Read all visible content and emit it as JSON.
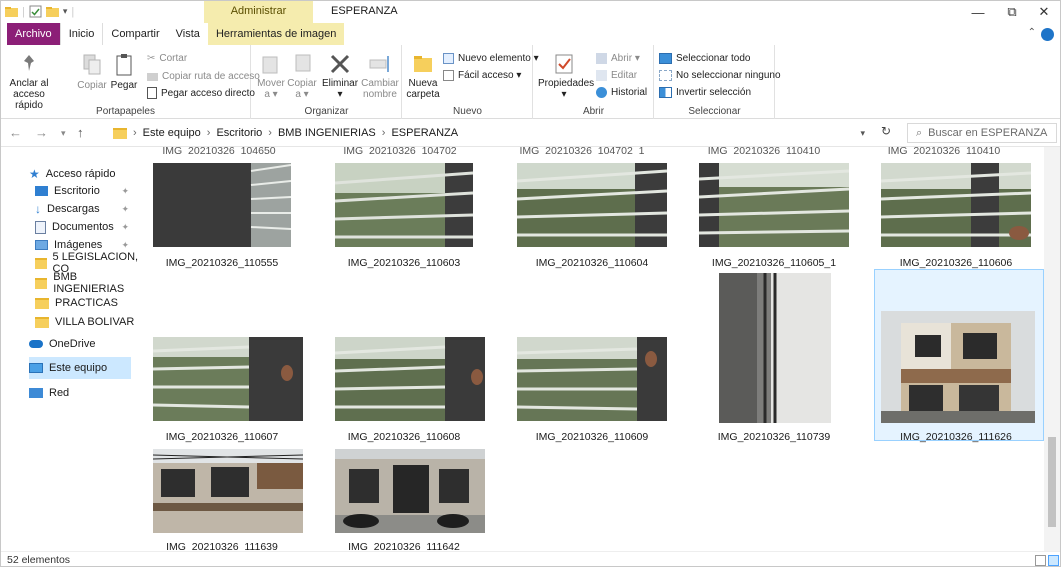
{
  "titlebar": {
    "context_tab_header": "Administrar",
    "window_title": "ESPERANZA",
    "controls": {
      "minimize": "—",
      "maximize": "⧉",
      "close": "✕"
    }
  },
  "ribbon_tabs": {
    "file": "Archivo",
    "home": "Inicio",
    "share": "Compartir",
    "view": "Vista",
    "image_tools": "Herramientas de imagen"
  },
  "ribbon": {
    "portapapeles": {
      "label": "Portapapeles",
      "pin_line1": "Anclar al",
      "pin_line2": "acceso rápido",
      "copy": "Copiar",
      "paste": "Pegar",
      "cut": "Cortar",
      "copy_path": "Copiar ruta de acceso",
      "paste_shortcut": "Pegar acceso directo"
    },
    "organizar": {
      "label": "Organizar",
      "move_line1": "Mover",
      "move_line2": "a ▾",
      "copyto_line1": "Copiar",
      "copyto_line2": "a ▾",
      "delete": "Eliminar",
      "delete_arrow": "▾",
      "rename_line1": "Cambiar",
      "rename_line2": "nombre"
    },
    "nuevo": {
      "label": "Nuevo",
      "new_folder_line1": "Nueva",
      "new_folder_line2": "carpeta",
      "new_item": "Nuevo elemento ▾",
      "easy_access": "Fácil acceso ▾"
    },
    "abrir": {
      "label": "Abrir",
      "properties": "Propiedades",
      "properties_arrow": "▾",
      "open": "Abrir ▾",
      "edit": "Editar",
      "history": "Historial"
    },
    "seleccionar": {
      "label": "Seleccionar",
      "select_all": "Seleccionar todo",
      "select_none": "No seleccionar ninguno",
      "invert": "Invertir selección"
    }
  },
  "address": {
    "breadcrumbs": [
      "Este equipo",
      "Escritorio",
      "BMB INGENIERIAS",
      "ESPERANZA"
    ],
    "search_placeholder": "Buscar en ESPERANZA"
  },
  "nav_pane": {
    "quick_access": "Acceso rápido",
    "items": [
      {
        "label": "Escritorio",
        "pinned": true
      },
      {
        "label": "Descargas",
        "pinned": true
      },
      {
        "label": "Documentos",
        "pinned": true
      },
      {
        "label": "Imágenes",
        "pinned": true
      },
      {
        "label": "5 LEGISLACION, CO",
        "pinned": false
      },
      {
        "label": "BMB INGENIERIAS",
        "pinned": false
      },
      {
        "label": "PRACTICAS",
        "pinned": false
      },
      {
        "label": "VILLA BOLIVAR",
        "pinned": false
      }
    ],
    "onedrive": "OneDrive",
    "this_pc": "Este equipo",
    "network": "Red"
  },
  "files": {
    "row_top_partial": [
      "IMG_20210326_104650",
      "IMG_20210326_104702",
      "IMG_20210326_104702_1",
      "IMG_20210326_110410",
      "IMG_20210326_110410"
    ],
    "row1": [
      "IMG_20210326_110555",
      "IMG_20210326_110603",
      "IMG_20210326_110604",
      "IMG_20210326_110605_1",
      "IMG_20210326_110606"
    ],
    "row2": [
      "IMG_20210326_110607",
      "IMG_20210326_110608",
      "IMG_20210326_110609",
      "IMG_20210326_110739",
      "IMG_20210326_111626"
    ],
    "row3": [
      "IMG_20210326_111639",
      "IMG_20210326_111642"
    ]
  },
  "status": {
    "count": "52 elementos"
  },
  "colors": {
    "file_tab": "#8c1f77",
    "context_band": "#f5ecae",
    "selection": "#cce8ff"
  }
}
